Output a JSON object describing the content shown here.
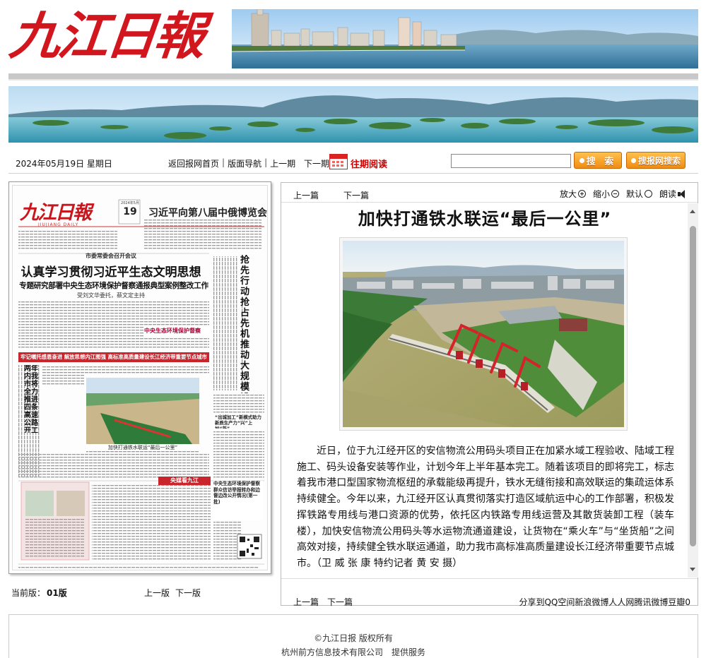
{
  "masthead": {
    "logo_text": "九江日報"
  },
  "toolbar": {
    "date": "2024年05月19日 星期日",
    "nav_home": "返回报网首页",
    "nav_layout": "版面导航",
    "nav_prev": "上一期",
    "nav_next": "下一期",
    "archive": "往期阅读",
    "search_button": "搜 索",
    "site_search_button": "搜报网搜索"
  },
  "newspaper_page": {
    "logo": "九江日報",
    "logo_en": "JIUJIANG DAILY",
    "date_box_day": "19",
    "date_box_top": "2024年5月",
    "headline_top": "习近平向第八届中俄博览会致贺信",
    "headline_main_kicker": "市委常委会召开会议",
    "headline_main_1": "认真学习贯彻习近平生态文明思想",
    "headline_main_2": "专题研究部署中央生态环境保护督察通报典型案例整改工作",
    "headline_main_byline": "受刘文华委托，蔡文定主持",
    "headline_vertical": "抢先行动抢占先机 推动大规模设备更新和消费品以旧换新取得实效",
    "badge_inspection": "中央生态环境保护督察",
    "red_banner": "牢记嘱托感恩奋进 解放思想内江图强 高标准高质量建设长江经济带重要节点城市",
    "headline_side": "两年内我市将全力推进四条高速公路开工建设",
    "photo_caption": "加快打通铁水联运“最后一公里”",
    "feature_label": "央媒看九江",
    "side_box_title": "中央生态环境保护督察群众信访举报转办和边督边改公开情况(第一批)",
    "small_heading": "“出城加工”新模式助力新质生产力“兴”上加“新”"
  },
  "edition_bar": {
    "label": "当前版：",
    "edition": "01版",
    "prev": "上一版",
    "next": "下一版"
  },
  "article": {
    "nav_prev": "上一篇",
    "nav_next": "下一篇",
    "tools": {
      "enlarge": "放大",
      "shrink": "缩小",
      "default": "默认",
      "read_aloud": "朗读"
    },
    "title": "加快打通铁水联运“最后一公里”",
    "body": "近日，位于九江经开区的安信物流公用码头项目正在加紧水域工程验收、陆域工程施工、码头设备安装等作业，计划今年上半年基本完工。随着该项目的即将完工，标志着我市港口型国家物流枢纽的承载能级再提升，铁水无缝衔接和高效联运的集疏运体系持续健全。今年以来，九江经开区认真贯彻落实打造区域航运中心的工作部署，积极发挥铁路专用线与港口资源的优势，依托区内铁路专用线运营及其散货装卸工程（装车楼），加快安信物流公用码头等水运物流通道建设，让货物在“乘火车”与“坐货船”之间高效对接，持续健全铁水联运通道，助力我市高标准高质量建设长江经济带重要节点城市。（卫 威 张 康 特约记者 黄 安 摄）",
    "bottom_prev": "上一篇",
    "bottom_next": "下一篇",
    "share": "分享到QQ空间新浪微博人人网腾讯微博豆瓣0"
  },
  "footer": {
    "copyright": "©九江日报 版权所有",
    "provider": "杭州前方信息技术有限公司　提供服务"
  },
  "colors": {
    "brand_red": "#d2161e",
    "button_orange": "#f08c12",
    "archive_red": "#cc0000"
  }
}
